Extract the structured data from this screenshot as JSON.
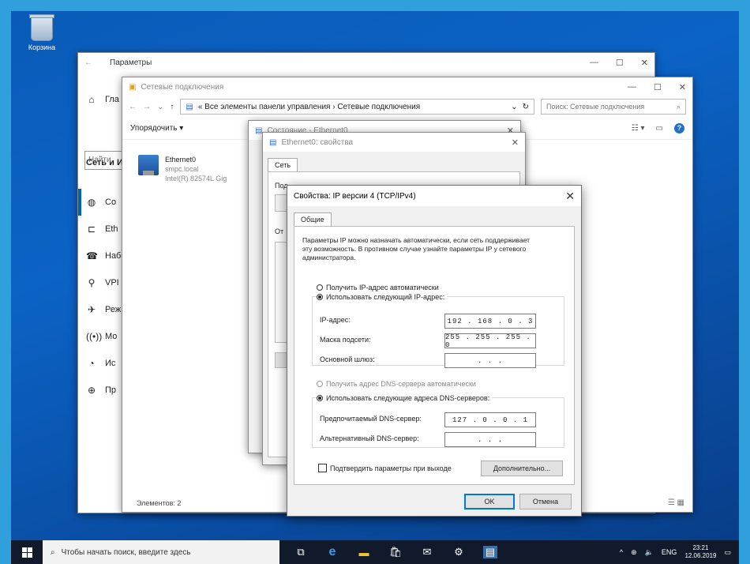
{
  "desktop": {
    "recycle_bin_label": "Корзина"
  },
  "settings": {
    "title": "Параметры",
    "home_label": "Гла",
    "search_placeholder": "Найти",
    "section_title": "Сеть и И",
    "items": [
      {
        "icon": "globe-icon",
        "label": "Со"
      },
      {
        "icon": "ethernet-icon",
        "label": "Eth"
      },
      {
        "icon": "dialup-icon",
        "label": "Наб"
      },
      {
        "icon": "vpn-icon",
        "label": "VPI"
      },
      {
        "icon": "flight-mode-icon",
        "label": "Реж"
      },
      {
        "icon": "hotspot-icon",
        "label": "Мо"
      },
      {
        "icon": "data-usage-icon",
        "label": "Ис"
      },
      {
        "icon": "proxy-icon",
        "label": "Пр"
      }
    ]
  },
  "netconn": {
    "title": "Сетевые подключения",
    "address_path": "« Все элементы панели управления  ›  Сетевые подключения",
    "search_placeholder": "Поиск: Сетевые подключения",
    "organize_label": "Упорядочить ▾",
    "adapter": {
      "name": "Ethernet0",
      "network": "smpc.local",
      "device": "Intel(R) 82574L Gig"
    },
    "status_count": "Элементов: 2"
  },
  "eth_status_dialog": {
    "title": "Состояние - Ethernet0"
  },
  "eth_props_dialog": {
    "title": "Ethernet0: свойства",
    "tab": "Сеть",
    "connect_label": "Под",
    "components_label": "От"
  },
  "ipv4": {
    "title": "Свойства: IP версии 4 (TCP/IPv4)",
    "tab": "Общие",
    "description": "Параметры IP можно назначать автоматически, если сеть поддерживает эту возможность. В противном случае узнайте параметры IP у сетевого администратора.",
    "auto_ip_label": "Получить IP-адрес автоматически",
    "manual_ip_label": "Использовать следующий IP-адрес:",
    "ip_label": "IP-адрес:",
    "ip_value": "192 . 168 .  0  .  3",
    "mask_label": "Маска подсети:",
    "mask_value": "255 . 255 . 255 .  0",
    "gateway_label": "Основной шлюз:",
    "gateway_value": " .   .   . ",
    "auto_dns_label": "Получить адрес DNS-сервера автоматически",
    "manual_dns_label": "Использовать следующие адреса DNS-серверов:",
    "pref_dns_label": "Предпочитаемый DNS-сервер:",
    "pref_dns_value": "127 .  0  .  0  .  1",
    "alt_dns_label": "Альтернативный DNS-сервер:",
    "alt_dns_value": " .   .   . ",
    "validate_label": "Подтвердить параметры при выходе",
    "advanced_label": "Дополнительно...",
    "ok_label": "OK",
    "cancel_label": "Отмена"
  },
  "taskbar": {
    "search_placeholder": "Чтобы начать поиск, введите здесь",
    "lang": "ENG",
    "time": "23:21",
    "date": "12.06.2019"
  }
}
